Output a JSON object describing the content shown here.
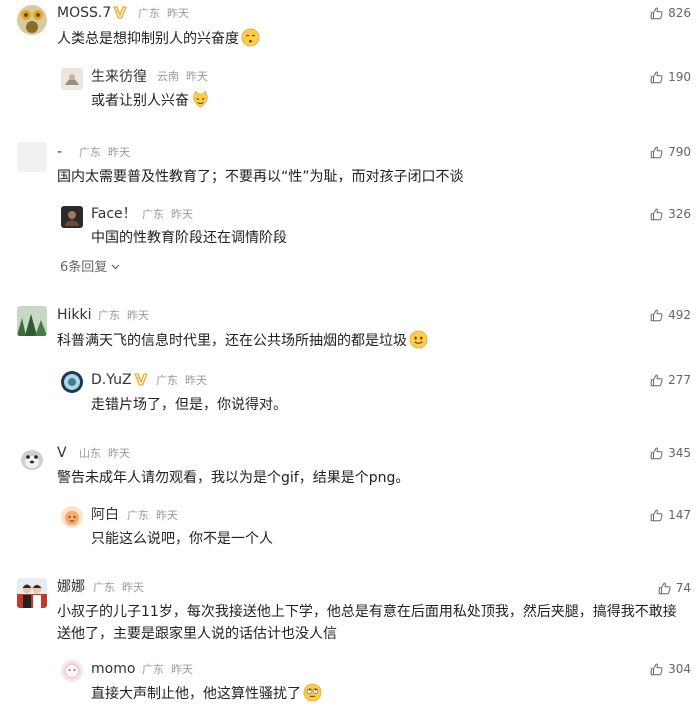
{
  "comments": [
    {
      "name": "MOSS.7",
      "badge": "V",
      "loc": "广东",
      "time": "昨天",
      "text": "人类总是想抑制别人的兴奋度",
      "likes": "826",
      "emoji": "relieved-emoji",
      "reply": {
        "name": "生来彷徨",
        "loc": "云南",
        "time": "昨天",
        "text": "或者让别人兴奋",
        "likes": "190",
        "emoji": "cat-emoji"
      }
    },
    {
      "name": "-",
      "loc": "广东",
      "time": "昨天",
      "text": "国内太需要普及性教育了；不要再以“性”为耻，而对孩子闭口不谈",
      "likes": "790",
      "reply": {
        "name": "Face！",
        "loc": "广东",
        "time": "昨天",
        "text": "中国的性教育阶段还在调情阶段",
        "likes": "326"
      },
      "more_replies": "6条回复"
    },
    {
      "name": "Hikki",
      "loc": "广东",
      "time": "昨天",
      "text": "科普满天飞的信息时代里，还在公共场所抽烟的都是垃圾",
      "likes": "492",
      "emoji": "smile-emoji",
      "reply": {
        "name": "D.YuZ",
        "badge": "V",
        "loc": "广东",
        "time": "昨天",
        "text": "走错片场了，但是，你说得对。",
        "likes": "277"
      }
    },
    {
      "name": "V",
      "loc": "山东",
      "time": "昨天",
      "text": "警告未成年人请勿观看，我以为是个gif，结果是个png。",
      "likes": "345",
      "reply": {
        "name": "阿白",
        "loc": "广东",
        "time": "昨天",
        "text": "只能这么说吧，你不是一个人",
        "likes": "147"
      }
    },
    {
      "name": "娜娜",
      "loc": "广东",
      "time": "昨天",
      "text": "小叔子的儿子11岁，每次我接送他上下学，他总是有意在后面用私处顶我，然后夹腿，搞得我不敢接送他了，主要是跟家里人说的话估计也没人信",
      "likes": "74",
      "reply": {
        "name": "momo",
        "loc": "广东",
        "time": "昨天",
        "text": "直接大声制止他，他这算性骚扰了",
        "likes": "304",
        "emoji": "eyeroll-emoji"
      }
    }
  ],
  "colors": {
    "name": "#333333",
    "meta": "#999999",
    "text": "#222222",
    "like": "#666666",
    "badge": "#f5a623"
  }
}
